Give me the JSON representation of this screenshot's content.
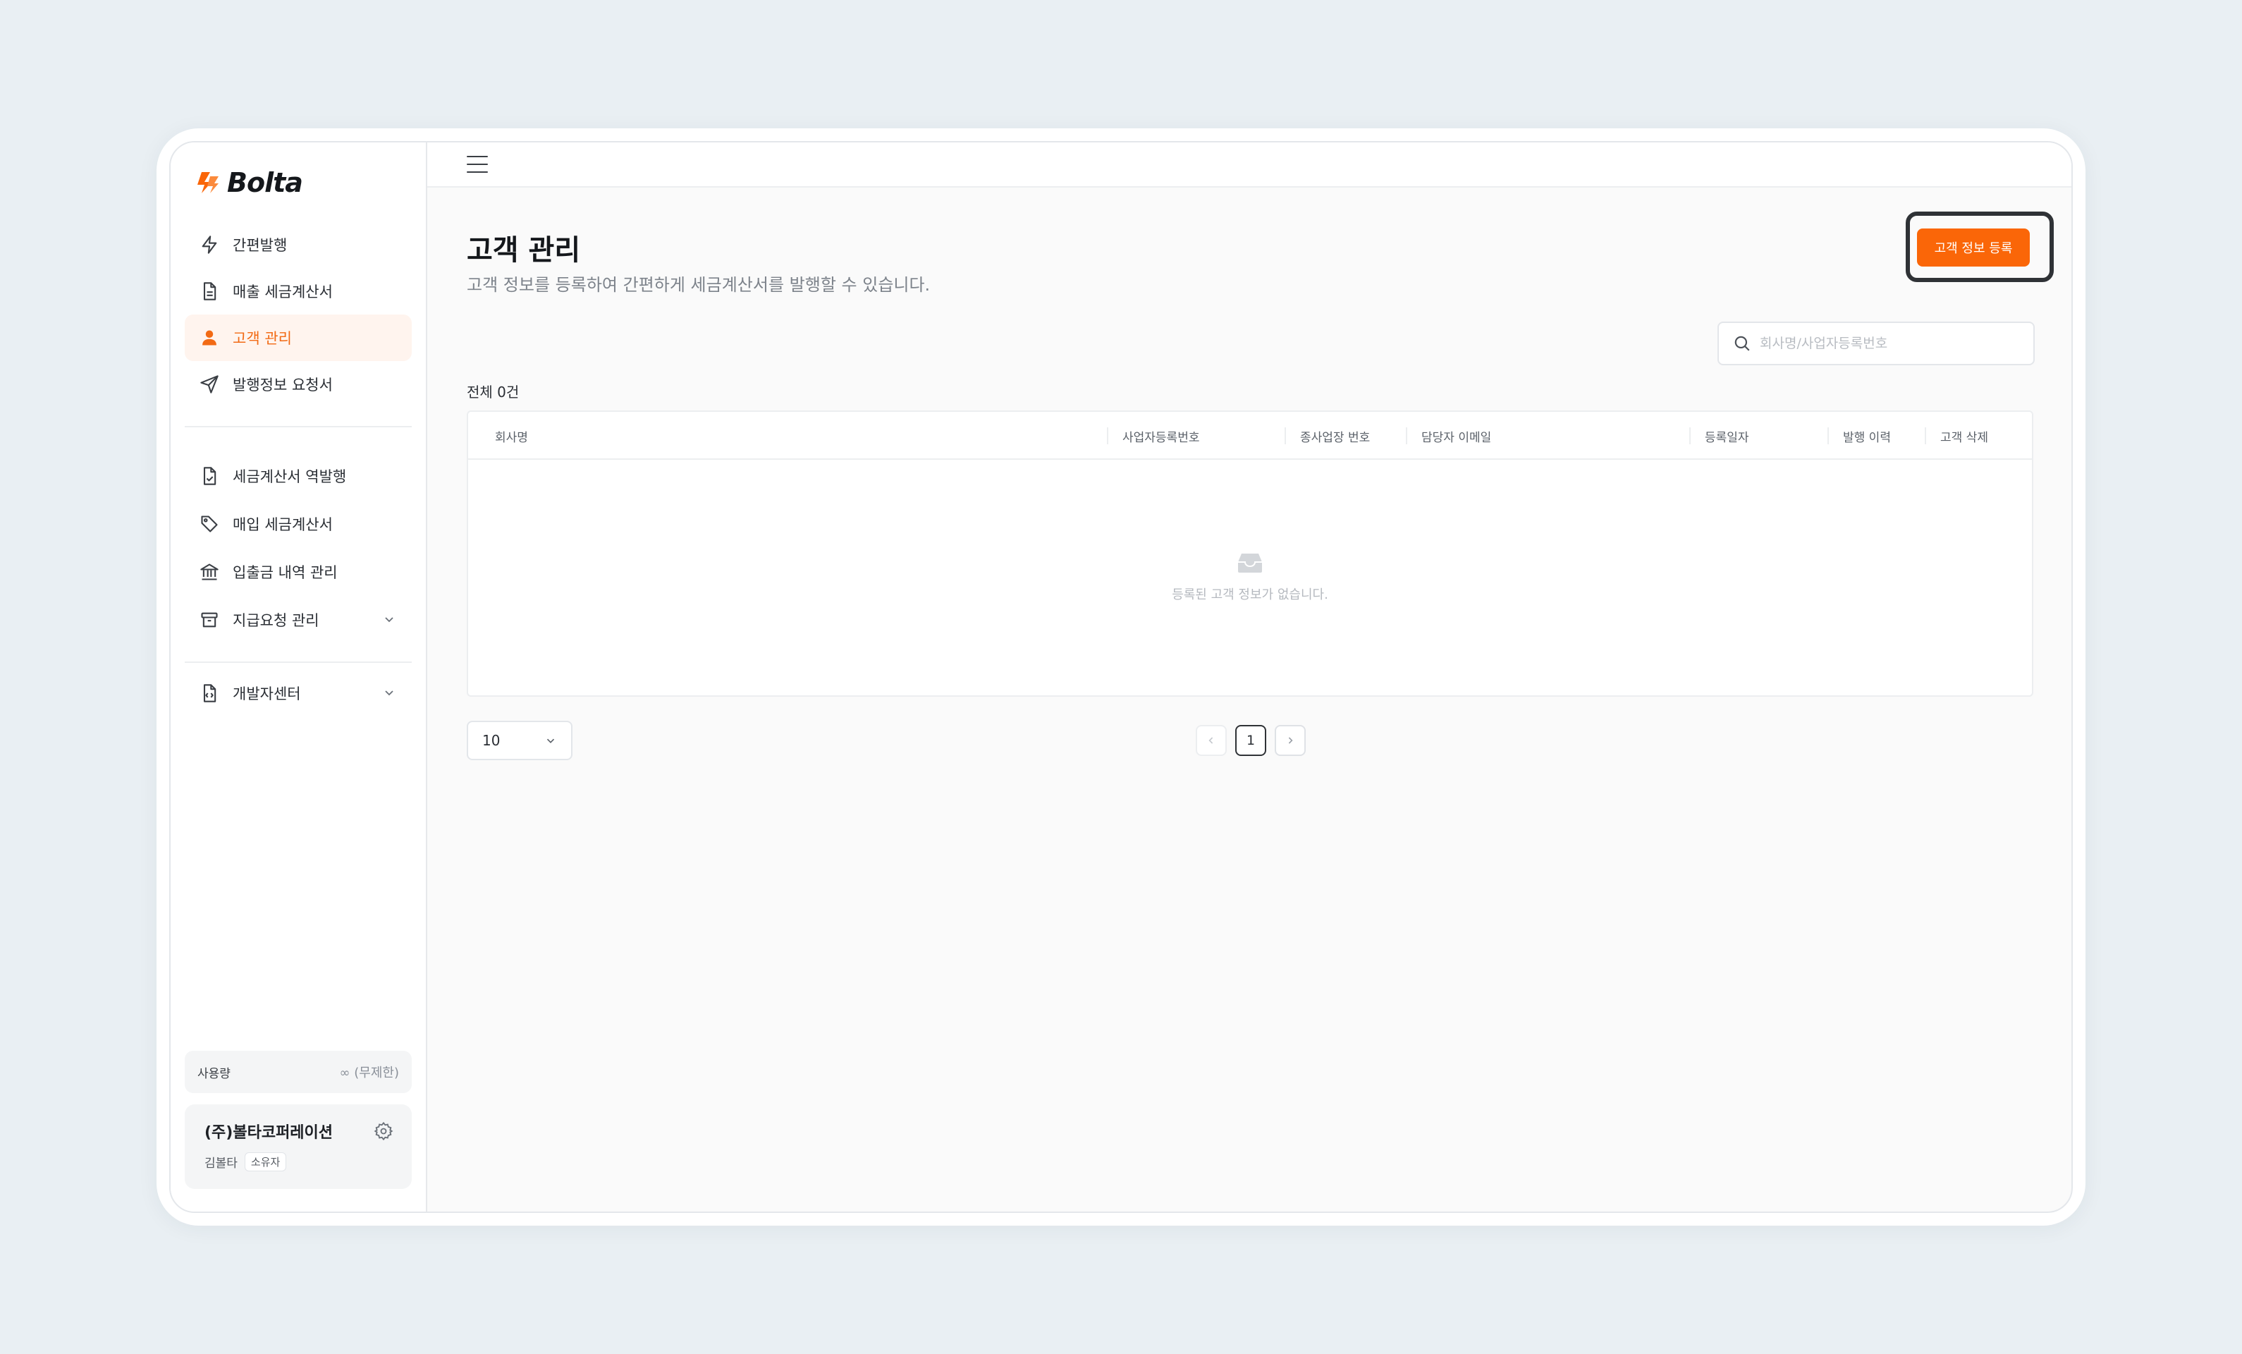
{
  "brand": {
    "name": "Bolta",
    "accent": "#fa6608"
  },
  "sidebar": {
    "nav_primary": [
      {
        "label": "간편발행",
        "icon": "bolt-icon"
      },
      {
        "label": "매출 세금계산서",
        "icon": "document-icon"
      },
      {
        "label": "고객 관리",
        "icon": "user-icon",
        "active": true
      },
      {
        "label": "발행정보 요청서",
        "icon": "send-icon"
      }
    ],
    "nav_secondary": [
      {
        "label": "세금계산서 역발행",
        "icon": "file-check-icon"
      },
      {
        "label": "매입 세금계산서",
        "icon": "tag-icon"
      },
      {
        "label": "입출금 내역 관리",
        "icon": "bank-icon"
      },
      {
        "label": "지급요청 관리",
        "icon": "archive-icon"
      }
    ],
    "nav_tertiary": [
      {
        "label": "개발자센터",
        "icon": "code-file-icon"
      }
    ],
    "usage": {
      "label": "사용량",
      "value": "(무제한)"
    },
    "company": {
      "name": "(주)볼타코퍼레이션",
      "owner": "김볼타",
      "role": "소유자"
    }
  },
  "main": {
    "title": "고객 관리",
    "description": "고객 정보를 등록하여 간편하게 세금계산서를 발행할 수 있습니다.",
    "register_button": "고객 정보 등록",
    "search_placeholder": "회사명/사업자등록번호",
    "count_label": "전체 0건",
    "columns": [
      "회사명",
      "사업자등록번호",
      "종사업장 번호",
      "담당자 이메일",
      "등록일자",
      "발행 이력",
      "고객 삭제"
    ],
    "empty_text": "등록된 고객 정보가 없습니다.",
    "page_size": "10",
    "current_page": "1"
  }
}
